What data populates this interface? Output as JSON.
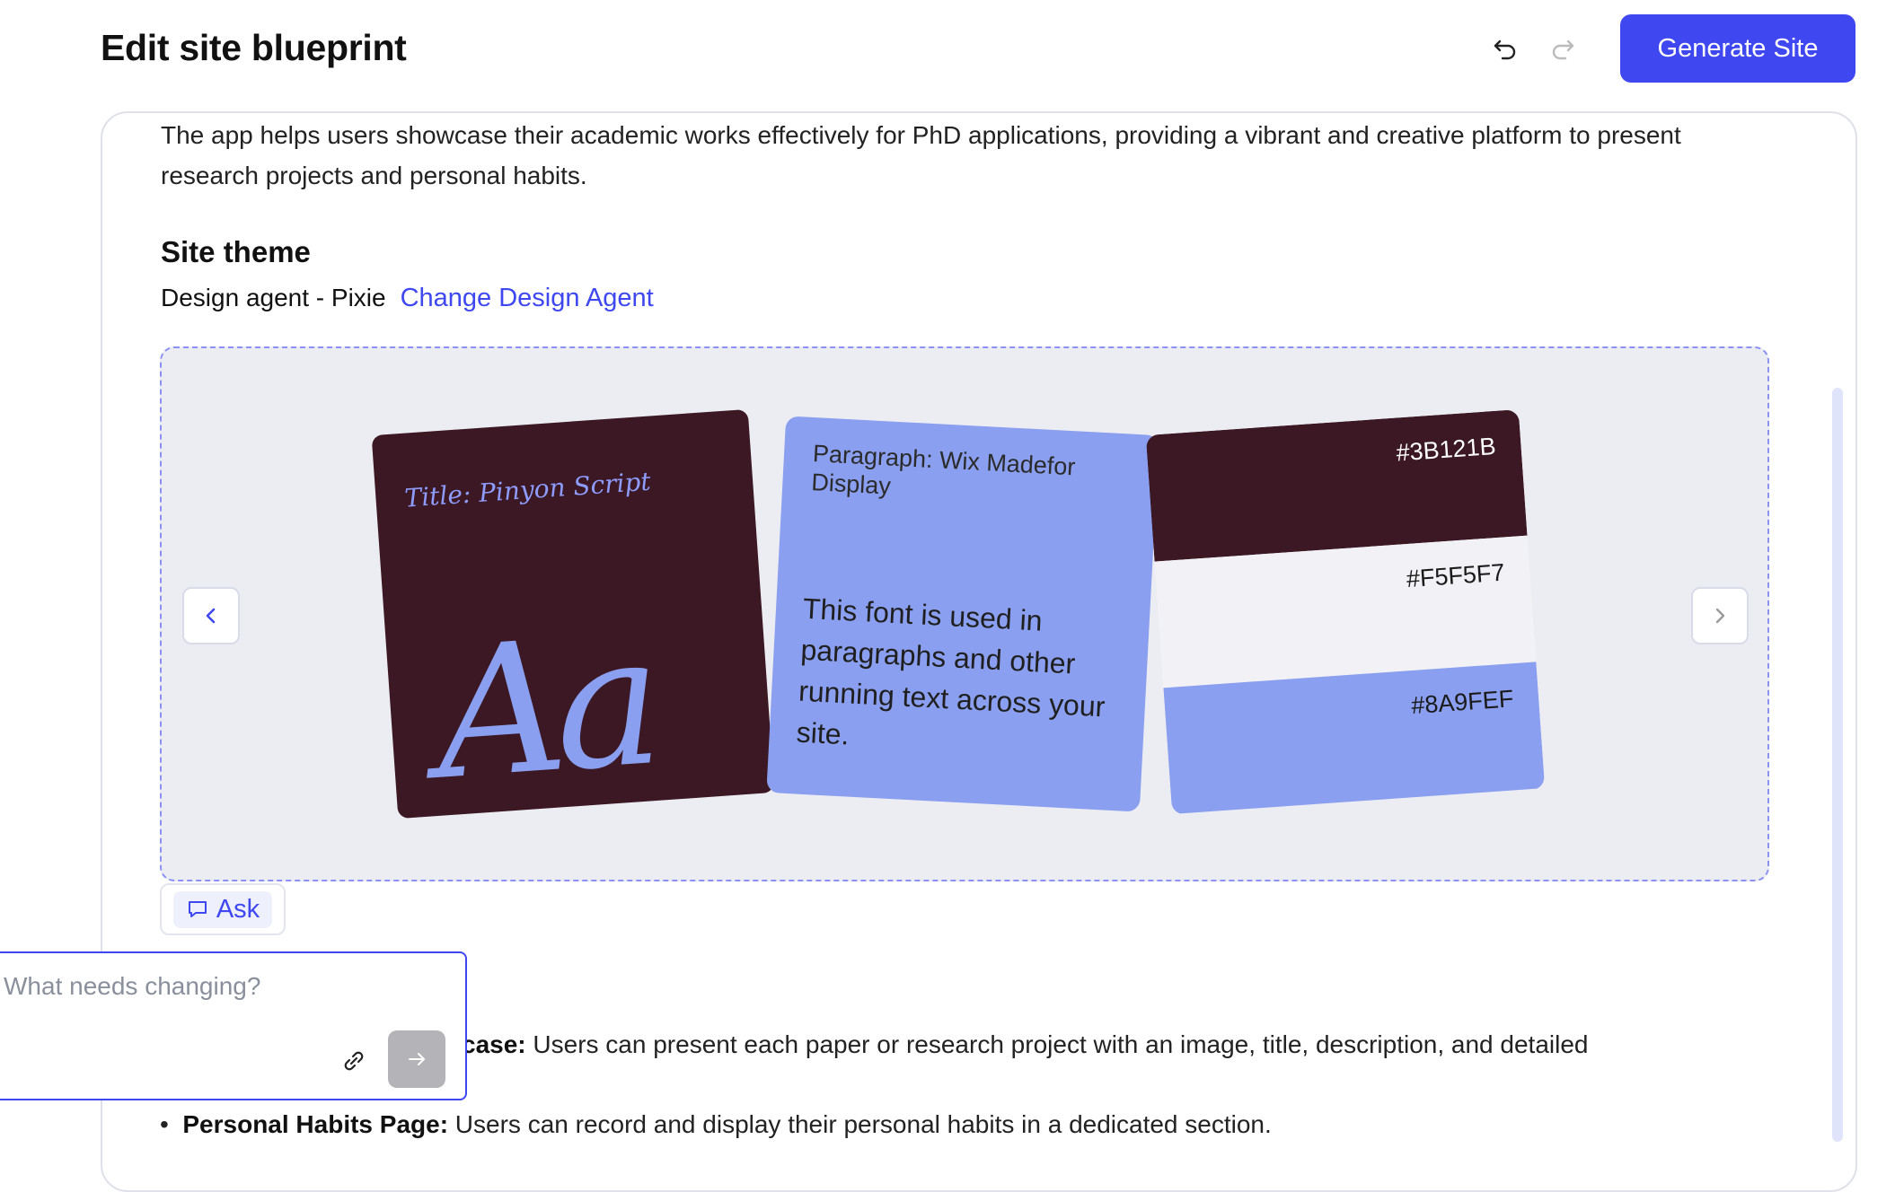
{
  "header": {
    "title": "Edit site blueprint",
    "generate_label": "Generate Site"
  },
  "intro": {
    "text": "The app helps users showcase their academic works effectively for PhD applications, providing a vibrant and creative platform to present research projects and personal habits."
  },
  "theme": {
    "heading": "Site theme",
    "agent_text": "Design agent - Pixie",
    "change_agent_label": "Change Design Agent",
    "font_card": {
      "title_label": "Title: Pinyon Script",
      "sample": "Aa"
    },
    "paragraph_card": {
      "label": "Paragraph: Wix Madefor Display",
      "text": "This font is used in paragraphs and other running text across your site."
    },
    "palette": [
      {
        "hex": "#3B121B",
        "color": "#3b1823",
        "text_color": "#ffffff"
      },
      {
        "hex": "#F5F5F7",
        "color": "#f2f2f6",
        "text_color": "#1a1a1a"
      },
      {
        "hex": "#8A9FEF",
        "color": "#8a9fef",
        "text_color": "#1a1a1a"
      }
    ]
  },
  "ask": {
    "label": "Ask"
  },
  "features": {
    "line1_bold": "case:",
    "line1_text": " Users can present each paper or research project with an image, title, description, and detailed",
    "line2_bold": "Personal Habits Page:",
    "line2_text": " Users can record and display their personal habits in a dedicated section."
  },
  "change_popup": {
    "placeholder": "What needs changing?"
  },
  "colors": {
    "accent": "#3e47f0"
  }
}
